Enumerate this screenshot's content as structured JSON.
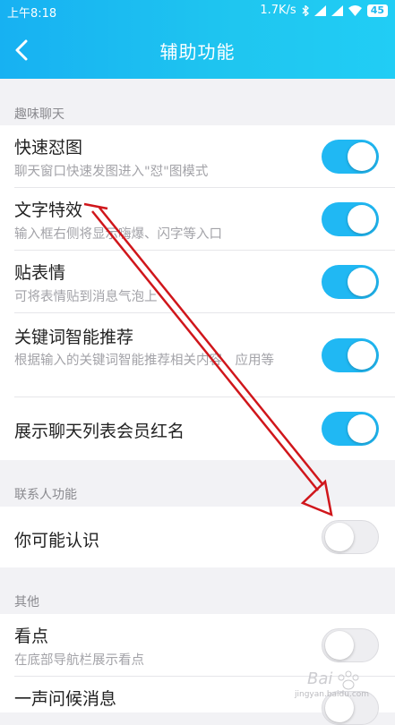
{
  "status": {
    "time": "上午8:18",
    "speed": "1.7K/s",
    "battery": "45"
  },
  "nav": {
    "title": "辅助功能"
  },
  "sections": {
    "fun": "趣味聊天",
    "contacts": "联系人功能",
    "other": "其他"
  },
  "rows": [
    {
      "title": "快速怼图",
      "subtitle": "聊天窗口快速发图进入\"怼\"图模式",
      "on": true
    },
    {
      "title": "文字特效",
      "subtitle": "输入框右侧将显示嗨爆、闪字等入口",
      "on": true
    },
    {
      "title": "贴表情",
      "subtitle": "可将表情贴到消息气泡上",
      "on": true
    },
    {
      "title": "关键词智能推荐",
      "subtitle": "根据输入的关键词智能推荐相关内容、应用等",
      "on": true
    },
    {
      "title": "展示聊天列表会员红名",
      "subtitle": "",
      "on": true
    },
    {
      "title": "你可能认识",
      "subtitle": "",
      "on": false
    },
    {
      "title": "看点",
      "subtitle": "在底部导航栏展示看点",
      "on": false
    },
    {
      "title": "一声问候消息",
      "subtitle": "",
      "on": false
    }
  ],
  "watermark": {
    "brand": "Bai",
    "sub": "jingyan.baidu.com"
  },
  "colors": {
    "header": "#1fbcf1",
    "toggle_on": "#20b8f3",
    "arrow": "#d0161b"
  }
}
